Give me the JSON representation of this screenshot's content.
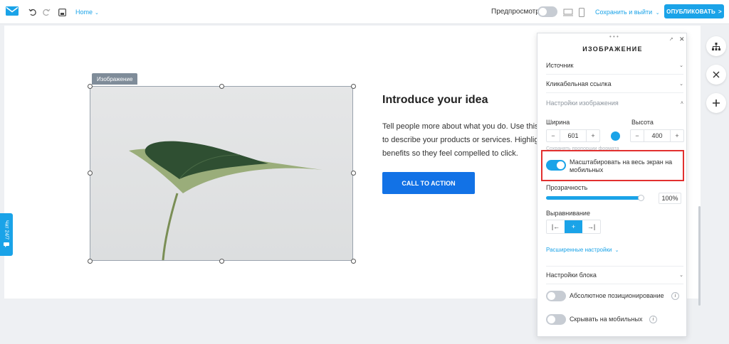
{
  "toolbar": {
    "page_select": "Home",
    "preview_label": "Предпросмотр",
    "preview_on": false,
    "save_exit_label": "Сохранить и выйти",
    "publish_label": "ОПУБЛИКОВАТЬ",
    "publish_arrow": ">",
    "chevron": "⌄"
  },
  "canvas": {
    "image_tag": "Изображение",
    "heading": "Introduce your idea",
    "body_lines": [
      "Tell people more about what you do. Use this",
      "to describe your products or services. Highlight",
      "benefits so they feel compelled to click."
    ],
    "cta_label": "CALL TO ACTION"
  },
  "chat": {
    "label": "Чат 24/7"
  },
  "panel": {
    "title": "ИЗОБРАЖЕНИЕ",
    "sections": {
      "source": "Источник",
      "link": "Кликабельная ссылка",
      "image_settings": "Настройки изображения",
      "block_settings": "Настройки блока"
    },
    "chevron_down": "⌄",
    "chevron_up": "˄",
    "width_label": "Ширина",
    "width_value": "601",
    "height_label": "Высота",
    "height_value": "400",
    "minus": "−",
    "plus": "+",
    "keep_ratio_text": "Сохранять пропорции формата",
    "scale_mobile_line1": "Масштабировать на весь экран на",
    "scale_mobile_line2": "мобильных",
    "scale_mobile_on": true,
    "opacity_label": "Прозрачность",
    "opacity_value": "100%",
    "opacity_fraction": 1.0,
    "align_label": "Выравнивание",
    "align_options": [
      "|←",
      "+",
      "→|"
    ],
    "align_selected": 1,
    "advanced_label": "Расширенные настройки",
    "absolute_label": "Абсолютное позиционирование",
    "absolute_on": false,
    "hide_mobile_label": "Скрывать на мобильных",
    "hide_mobile_on": false,
    "info": "i"
  },
  "colors": {
    "accent": "#1aa3e8",
    "cta": "#1272e6",
    "highlight": "#e2302f"
  }
}
